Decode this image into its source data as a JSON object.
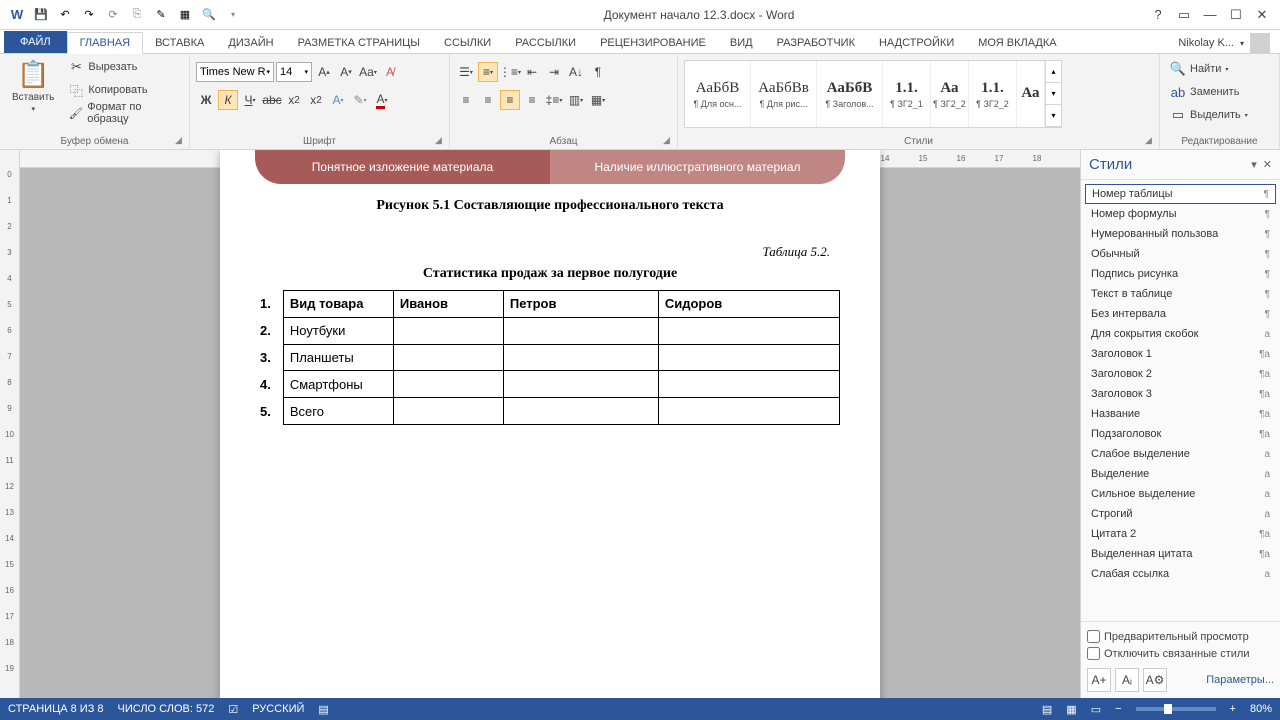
{
  "title": "Документ начало 12.3.docx - Word",
  "user": "Nikolay K...",
  "tabs": [
    "ФАЙЛ",
    "ГЛАВНАЯ",
    "ВСТАВКА",
    "ДИЗАЙН",
    "РАЗМЕТКА СТРАНИЦЫ",
    "ССЫЛКИ",
    "РАССЫЛКИ",
    "РЕЦЕНЗИРОВАНИЕ",
    "ВИД",
    "РАЗРАБОТЧИК",
    "НАДСТРОЙКИ",
    "МОЯ ВКЛАДКА"
  ],
  "active_tab": 1,
  "clipboard": {
    "paste": "Вставить",
    "cut": "Вырезать",
    "copy": "Копировать",
    "format": "Формат по образцу",
    "label": "Буфер обмена"
  },
  "font": {
    "name": "Times New R",
    "size": "14",
    "label": "Шрифт"
  },
  "paragraph": {
    "label": "Абзац"
  },
  "styles": {
    "label": "Стили",
    "items": [
      {
        "s": "АаБбВ",
        "n": "¶ Для осн..."
      },
      {
        "s": "АаБбВв",
        "n": "¶ Для рис..."
      },
      {
        "s": "АаБбВ",
        "n": "¶ Заголов...",
        "b": true
      },
      {
        "s": "1.1.",
        "n": "¶ ЗГ2_1",
        "b": true
      },
      {
        "s": "Аа",
        "n": "¶ ЗГ2_2",
        "b": true
      },
      {
        "s": "1.1.",
        "n": "¶ ЗГ2_2",
        "b": true
      },
      {
        "s": "Аа",
        "n": "",
        "b": true
      }
    ]
  },
  "editing": {
    "find": "Найти",
    "replace": "Заменить",
    "select": "Выделить",
    "label": "Редактирование"
  },
  "doc": {
    "sa1": "Понятное изложение материала",
    "sa2": "Наличие иллюстративного материал",
    "caption": "Рисунок 5.1 Составляющие профессионального текста",
    "tablabel": "Таблица 5.2.",
    "tabtitle": "Статистика продаж за первое полугодие",
    "headers": [
      "Вид товара",
      "Иванов",
      "Петров",
      "Сидоров"
    ],
    "rows": [
      "Ноутбуки",
      "Планшеты",
      "Смартфоны",
      "Всего"
    ],
    "nums": [
      "1.",
      "2.",
      "3.",
      "4.",
      "5."
    ]
  },
  "styles_pane": {
    "title": "Стили",
    "items": [
      {
        "n": "Номер таблицы",
        "m": "¶",
        "sel": true
      },
      {
        "n": "Номер формулы",
        "m": "¶"
      },
      {
        "n": "Нумерованный пользова",
        "m": "¶"
      },
      {
        "n": "Обычный",
        "m": "¶"
      },
      {
        "n": "Подпись рисунка",
        "m": "¶"
      },
      {
        "n": "Текст в таблице",
        "m": "¶"
      },
      {
        "n": "Без интервала",
        "m": "¶"
      },
      {
        "n": "Для сокрытия скобок",
        "m": "a"
      },
      {
        "n": "Заголовок 1",
        "m": "¶a"
      },
      {
        "n": "Заголовок 2",
        "m": "¶a"
      },
      {
        "n": "Заголовок 3",
        "m": "¶a"
      },
      {
        "n": "Название",
        "m": "¶a"
      },
      {
        "n": "Подзаголовок",
        "m": "¶a"
      },
      {
        "n": "Слабое выделение",
        "m": "a"
      },
      {
        "n": "Выделение",
        "m": "a"
      },
      {
        "n": "Сильное выделение",
        "m": "a"
      },
      {
        "n": "Строгий",
        "m": "a"
      },
      {
        "n": "Цитата 2",
        "m": "¶a"
      },
      {
        "n": "Выделенная цитата",
        "m": "¶a"
      },
      {
        "n": "Слабая ссылка",
        "m": "a"
      }
    ],
    "preview": "Предварительный просмотр",
    "linked": "Отключить связанные стили",
    "options": "Параметры..."
  },
  "status": {
    "page": "СТРАНИЦА 8 ИЗ 8",
    "words": "ЧИСЛО СЛОВ: 572",
    "lang": "РУССКИЙ",
    "zoom": "80%"
  }
}
